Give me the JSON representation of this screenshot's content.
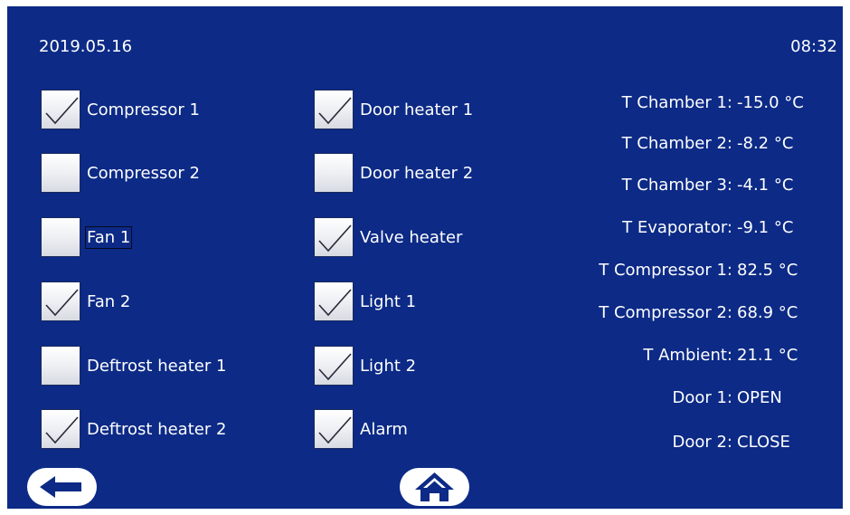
{
  "header": {
    "date": "2019.05.16",
    "time": "08:32"
  },
  "outputs_left": [
    {
      "label": "Compressor 1",
      "checked": true
    },
    {
      "label": "Compressor 2",
      "checked": false
    },
    {
      "label": "Fan 1",
      "checked": false
    },
    {
      "label": "Fan 2",
      "checked": true
    },
    {
      "label": "Deftrost heater 1",
      "checked": false
    },
    {
      "label": "Deftrost heater 2",
      "checked": true
    }
  ],
  "outputs_right": [
    {
      "label": "Door heater 1",
      "checked": true
    },
    {
      "label": "Door heater 2",
      "checked": false
    },
    {
      "label": "Valve heater",
      "checked": true
    },
    {
      "label": "Light 1",
      "checked": true
    },
    {
      "label": "Light 2",
      "checked": true
    },
    {
      "label": "Alarm",
      "checked": true
    }
  ],
  "readings": [
    {
      "label": "T Chamber 1:",
      "value": "-15.0 °C"
    },
    {
      "label": "T Chamber 2:",
      "value": "-8.2 °C"
    },
    {
      "label": "T Chamber 3:",
      "value": "-4.1 °C"
    },
    {
      "label": "T Evaporator:",
      "value": "-9.1 °C"
    },
    {
      "label": "T Compressor 1:",
      "value": "82.5 °C"
    },
    {
      "label": "T Compressor 2:",
      "value": "68.9 °C"
    },
    {
      "label": "T Ambient:",
      "value": "21.1 °C"
    },
    {
      "label": "Door 1:",
      "value": "OPEN"
    },
    {
      "label": "Door 2:",
      "value": "CLOSE"
    }
  ],
  "nav": {
    "back_icon": "arrow-left-icon",
    "home_icon": "home-icon"
  }
}
